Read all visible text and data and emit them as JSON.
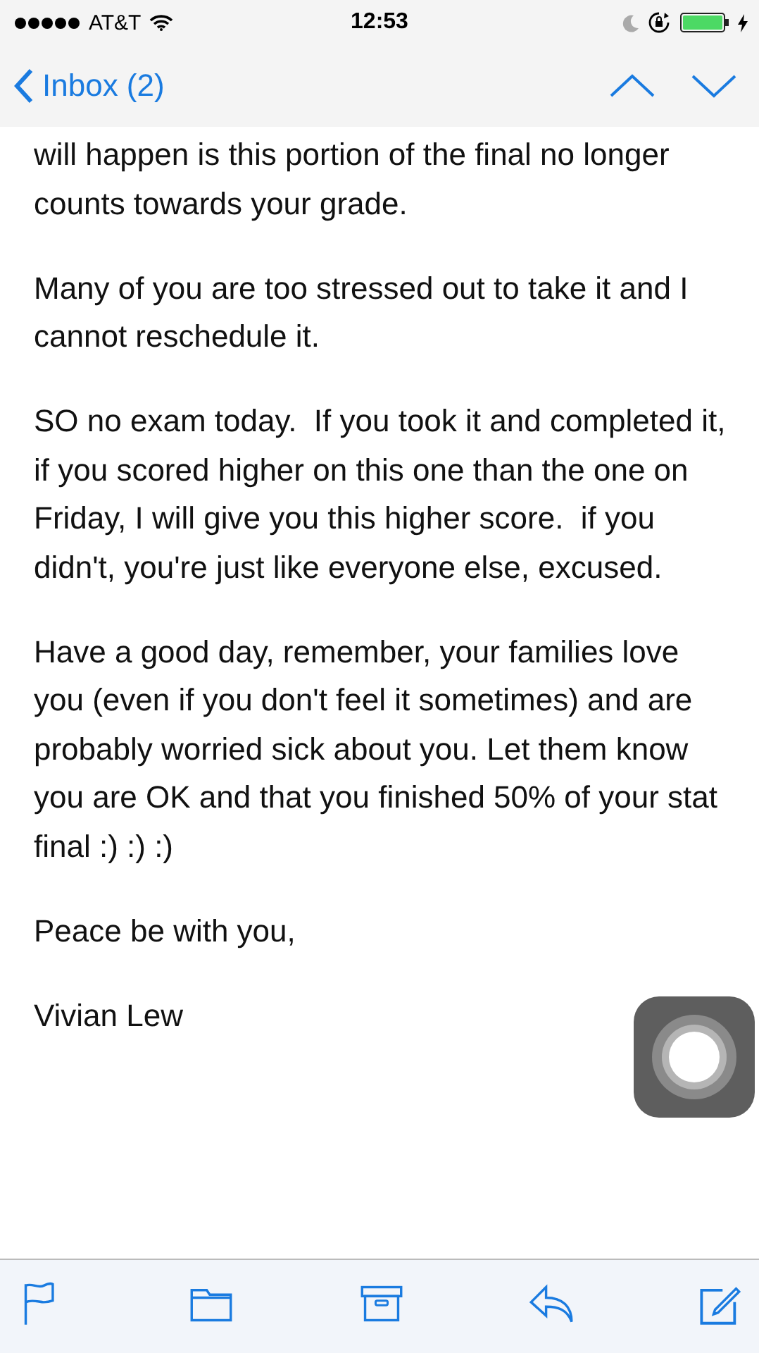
{
  "status_bar": {
    "carrier": "AT&T",
    "time": "12:53"
  },
  "nav_bar": {
    "back_label": "Inbox (2)"
  },
  "message": {
    "paragraphs": [
      "will happen is this portion of the final no longer counts towards your grade.",
      "Many of you are too stressed out to take it and I cannot reschedule it.",
      "SO no exam today.  If you took it and completed it, if you scored higher on this one than the one on Friday, I will give you this higher score.  if you didn't, you're just like everyone else, excused.",
      "Have a good day, remember, your families love you (even if you don't feel it sometimes) and are probably worried sick about you. Let them know you are OK and that you finished 50% of your stat final :) :) :)",
      "Peace be with you,",
      "Vivian Lew"
    ]
  },
  "toolbar": {
    "buttons": [
      {
        "kind": "flag"
      },
      {
        "kind": "folder"
      },
      {
        "kind": "archive"
      },
      {
        "kind": "reply"
      },
      {
        "kind": "compose"
      }
    ]
  }
}
